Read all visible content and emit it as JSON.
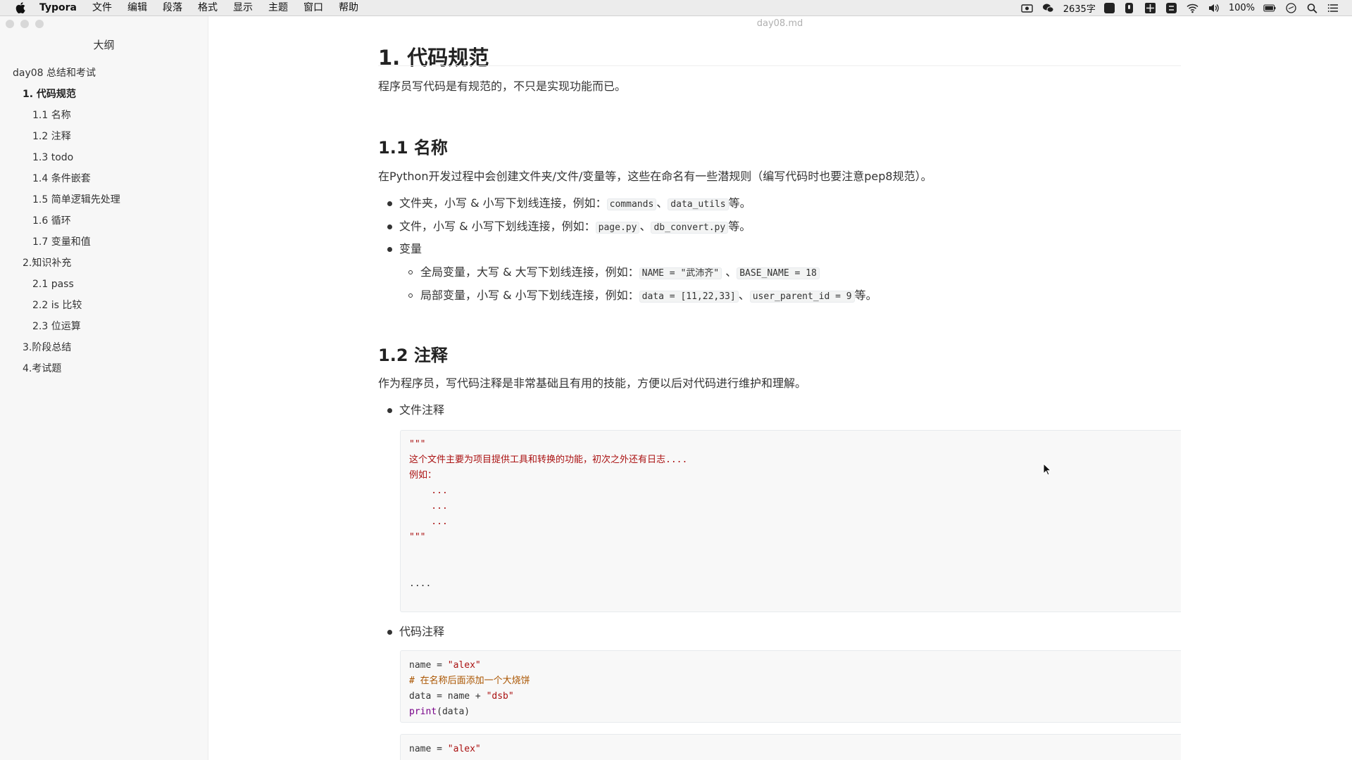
{
  "menubar": {
    "app_name": "Typora",
    "menus": [
      "文件",
      "编辑",
      "段落",
      "格式",
      "显示",
      "主题",
      "窗口",
      "帮助"
    ],
    "word_count": "2635字",
    "battery": "100%"
  },
  "window": {
    "filename": "day08.md"
  },
  "sidebar": {
    "title": "大纲",
    "items": [
      {
        "label": "day08 总结和考试"
      },
      {
        "label": "1. 代码规范"
      },
      {
        "label": "1.1 名称"
      },
      {
        "label": "1.2 注释"
      },
      {
        "label": "1.3 todo"
      },
      {
        "label": "1.4 条件嵌套"
      },
      {
        "label": "1.5 简单逻辑先处理"
      },
      {
        "label": "1.6 循环"
      },
      {
        "label": "1.7 变量和值"
      },
      {
        "label": "2.知识补充"
      },
      {
        "label": "2.1 pass"
      },
      {
        "label": "2.2 is 比较"
      },
      {
        "label": "2.3 位运算"
      },
      {
        "label": "3.阶段总结"
      },
      {
        "label": "4.考试题"
      }
    ]
  },
  "doc": {
    "h1": "1. 代码规范",
    "intro": "程序员写代码是有规范的，不只是实现功能而已。",
    "s11": {
      "title": "1.1 名称",
      "para": "在Python开发过程中会创建文件夹/文件/变量等，这些在命名有一些潜规则（编写代码时也要注意pep8规范）。",
      "b1_text": "文件夹，小写 & 小写下划线连接，例如：",
      "b1_code1": "commands",
      "b1_sep": "、",
      "b1_code2": "data_utils",
      "b1_end": "等。",
      "b2_text": "文件，小写 & 小写下划线连接，例如：",
      "b2_code1": "page.py",
      "b2_sep": "、",
      "b2_code2": "db_convert.py",
      "b2_end": "等。",
      "b3_text": "变量",
      "b3a_text": "全局变量，大写 & 大写下划线连接，例如：",
      "b3a_code1": "NAME = \"武沛齐\"",
      "b3a_sep": " 、",
      "b3a_code2": "BASE_NAME = 18",
      "b3b_text": "局部变量，小写 & 小写下划线连接，例如：",
      "b3b_code1": "data = [11,22,33]",
      "b3b_sep": "、",
      "b3b_code2": "user_parent_id = 9",
      "b3b_end": "等。"
    },
    "s12": {
      "title": "1.2 注释",
      "para": "作为程序员，写代码注释是非常基础且有用的技能，方便以后对代码进行维护和理解。",
      "b1_text": "文件注释",
      "code1": [
        "\"\"\"",
        "这个文件主要为项目提供工具和转换的功能，初次之外还有日志....",
        "例如：",
        "    ...",
        "    ...",
        "    ...",
        "\"\"\"",
        "",
        "",
        "...."
      ],
      "b2_text": "代码注释",
      "code2": {
        "l1_a": "name = ",
        "l1_b": "\"alex\"",
        "l2": "# 在名称后面添加一个大烧饼",
        "l3_a": "data = name + ",
        "l3_b": "\"dsb\"",
        "l4_a": "print",
        "l4_b": "(data)"
      },
      "code3": {
        "l1_a": "name = ",
        "l1_b": "\"alex\"",
        "l2": "\"\"\""
      }
    }
  }
}
